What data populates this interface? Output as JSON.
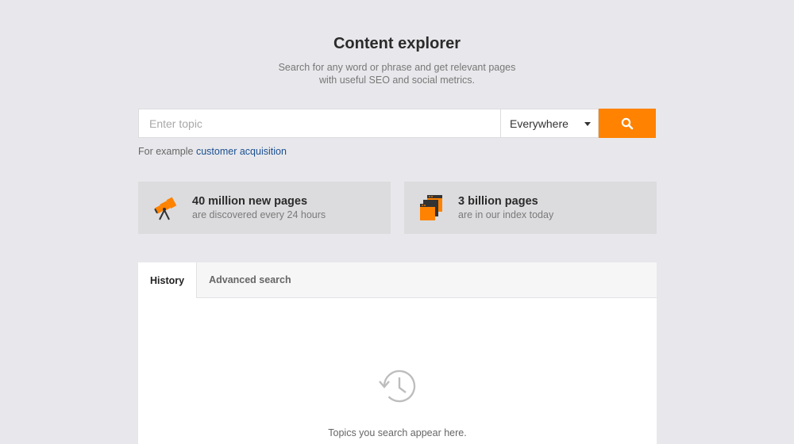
{
  "header": {
    "title": "Content explorer",
    "subtitle_line1": "Search for any word or phrase and get relevant pages",
    "subtitle_line2": "with useful SEO and social metrics."
  },
  "search": {
    "placeholder": "Enter topic",
    "value": "",
    "scope_selected": "Everywhere",
    "button_icon": "search-icon"
  },
  "example": {
    "prefix": "For example",
    "link_text": "customer acquisition"
  },
  "stats": [
    {
      "icon": "telescope-icon",
      "headline": "40 million new pages",
      "sub": "are discovered every 24 hours"
    },
    {
      "icon": "stacked-pages-icon",
      "headline": "3 billion pages",
      "sub": "are in our index today"
    }
  ],
  "tabs": [
    {
      "label": "History",
      "active": true
    },
    {
      "label": "Advanced search",
      "active": false
    }
  ],
  "history": {
    "empty_icon": "history-clock-icon",
    "empty_text": "Topics you search appear here."
  },
  "colors": {
    "accent": "#ff8200",
    "link": "#1b4f8f",
    "background": "#e8e8ec"
  }
}
